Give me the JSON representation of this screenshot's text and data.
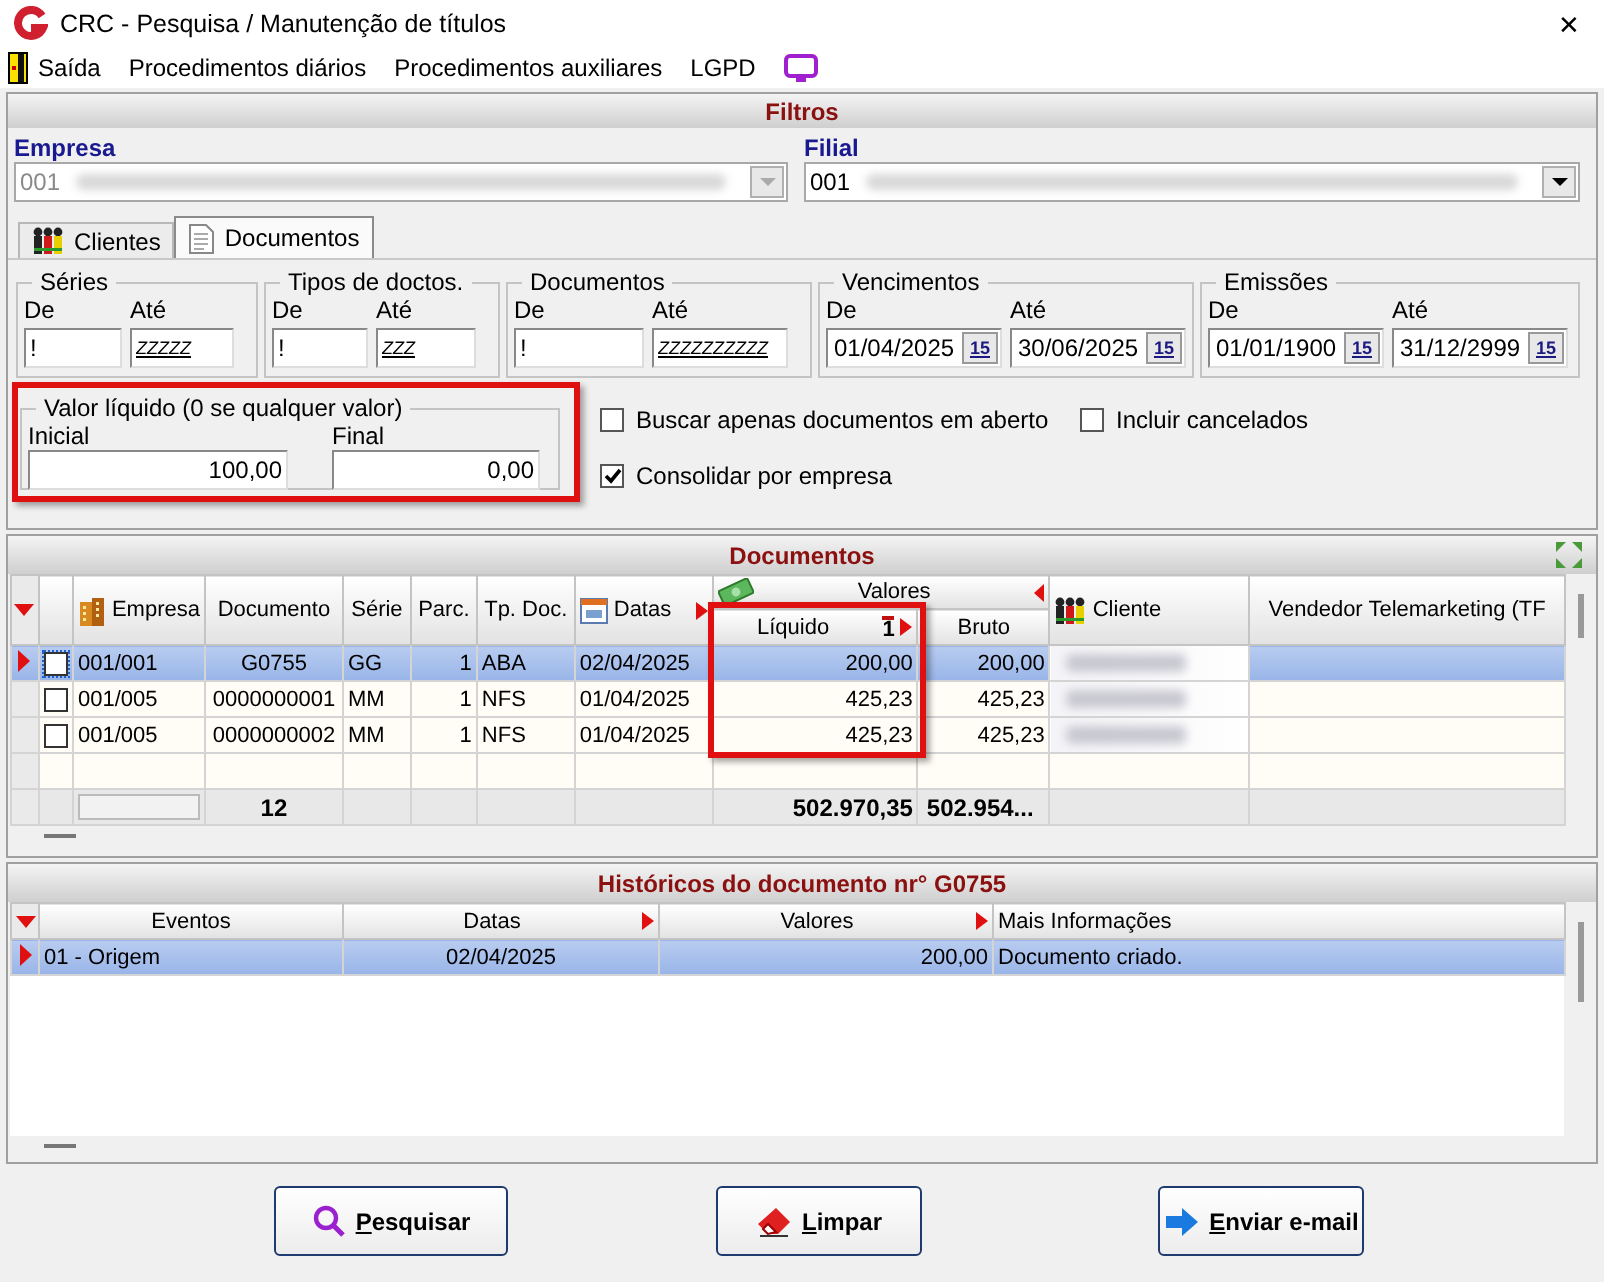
{
  "window": {
    "title": "CRC - Pesquisa / Manutenção de títulos",
    "close": "✕"
  },
  "menu": [
    {
      "kind": "exit",
      "label": "Saída"
    },
    {
      "kind": "text",
      "label": "Procedimentos diários"
    },
    {
      "kind": "text",
      "label": "Procedimentos auxiliares"
    },
    {
      "kind": "text",
      "label": "LGPD"
    },
    {
      "kind": "monitor"
    }
  ],
  "filters": {
    "title": "Filtros",
    "empresa": {
      "label": "Empresa",
      "value": "001",
      "disabled": true
    },
    "filial": {
      "label": "Filial",
      "value": "001",
      "disabled": false
    },
    "tabs": [
      {
        "label": "Clientes",
        "kind": "people",
        "selected": false
      },
      {
        "label": "Documentos",
        "kind": "document",
        "selected": true
      }
    ],
    "ranges": [
      {
        "title": "Séries",
        "kind": "text",
        "from_label": "De",
        "to_label": "Até",
        "from": "!",
        "to": "ZZZZZ"
      },
      {
        "title": "Tipos de doctos.",
        "kind": "text",
        "from_label": "De",
        "to_label": "Até",
        "from": "!",
        "to": "ZZZ"
      },
      {
        "title": "Documentos",
        "kind": "text",
        "from_label": "De",
        "to_label": "Até",
        "from": "!",
        "to": "ZZZZZZZZZZ"
      },
      {
        "title": "Vencimentos",
        "kind": "date",
        "from_label": "De",
        "to_label": "Até",
        "from": "01/04/2025",
        "to": "30/06/2025",
        "from_picker": "15",
        "to_picker": "15"
      },
      {
        "title": "Emissões",
        "kind": "date",
        "from_label": "De",
        "to_label": "Até",
        "from": "01/01/1900",
        "to": "31/12/2999",
        "from_picker": "15",
        "to_picker": "15"
      }
    ],
    "valor_liquido": {
      "title": "Valor líquido (0 se qualquer valor)",
      "highlighted": true,
      "initial_label": "Inicial",
      "initial": "100,00",
      "final_label": "Final",
      "final": "0,00"
    },
    "options": [
      {
        "label": "Buscar apenas documentos em aberto",
        "checked": false
      },
      {
        "label": "Incluir cancelados",
        "checked": false
      },
      {
        "label": "Consolidar por empresa",
        "checked": true
      }
    ]
  },
  "documents": {
    "title": "Documentos",
    "column_groups": [
      {
        "label": "Valores",
        "arrow": true
      }
    ],
    "columns": [
      {
        "label": "Empresa",
        "arrow": false,
        "highlighted": false
      },
      {
        "label": "Documento",
        "arrow": false,
        "highlighted": false
      },
      {
        "label": "Série",
        "arrow": false,
        "highlighted": false
      },
      {
        "label": "Parc.",
        "arrow": false,
        "highlighted": false
      },
      {
        "label": "Tp. Doc.",
        "arrow": false,
        "highlighted": false
      },
      {
        "label": "Datas",
        "arrow": true,
        "highlighted": false
      },
      {
        "label": "Líquido",
        "sort_order": "1",
        "arrow": true,
        "highlighted": true
      },
      {
        "label": "Bruto",
        "arrow": false,
        "highlighted": false
      },
      {
        "label": "Cliente",
        "arrow": false,
        "highlighted": false
      },
      {
        "label": "Vendedor Telemarketing (TF",
        "arrow": false,
        "highlighted": false
      }
    ],
    "rows": [
      {
        "selected": true,
        "checked": false,
        "client_blurred": true,
        "cells": [
          "001/001",
          "G0755",
          "GG",
          "1",
          "ABA",
          "02/04/2025",
          "200,00",
          "200,00"
        ]
      },
      {
        "selected": false,
        "checked": false,
        "client_blurred": true,
        "cells": [
          "001/005",
          "0000000001",
          "MM",
          "1",
          "NFS",
          "01/04/2025",
          "425,23",
          "425,23"
        ]
      },
      {
        "selected": false,
        "checked": false,
        "client_blurred": true,
        "cells": [
          "001/005",
          "0000000002",
          "MM",
          "1",
          "NFS",
          "01/04/2025",
          "425,23",
          "425,23"
        ]
      }
    ],
    "totals": {
      "count": "12",
      "liquido": "502.970,35",
      "bruto": "502.954..."
    }
  },
  "history": {
    "title": "Históricos do documento nr° G0755",
    "columns": [
      {
        "label": "Eventos",
        "arrow": false
      },
      {
        "label": "Datas",
        "arrow": true
      },
      {
        "label": "Valores",
        "arrow": true
      },
      {
        "label": "Mais Informações",
        "arrow": false
      }
    ],
    "rows": [
      {
        "selected": true,
        "cells": [
          "01 - Origem",
          "02/04/2025",
          "200,00",
          "Documento criado."
        ]
      }
    ]
  },
  "buttons": [
    {
      "kind": "search",
      "label": "Pesquisar"
    },
    {
      "kind": "clear",
      "label": "Limpar"
    },
    {
      "kind": "email",
      "label": "Enviar e-mail"
    }
  ]
}
